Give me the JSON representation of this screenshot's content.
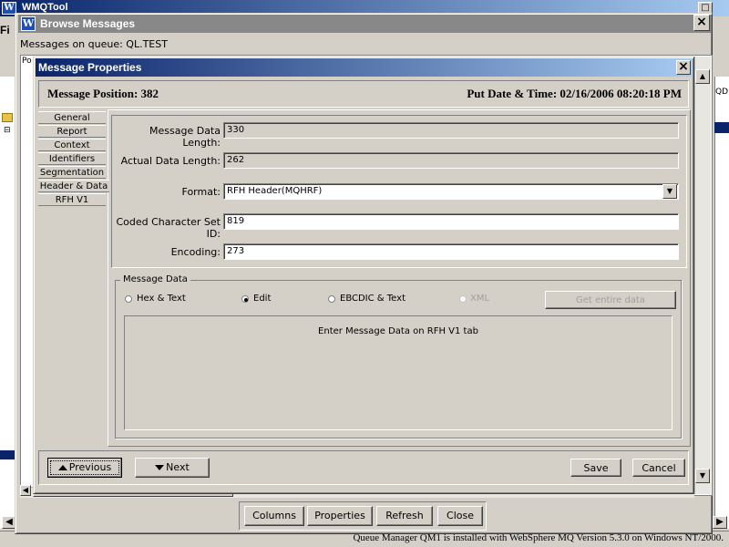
{
  "app": {
    "title": "WMQTool",
    "logo": "W",
    "menu_fragment": "Fi",
    "status_text": "Queue Manager QM1 is installed with WebSphere MQ Version 5.3.0 on Windows NT/2000."
  },
  "browse": {
    "title": "Browse Messages",
    "logo": "W",
    "queue_label": "Messages on queue: QL.TEST",
    "header_fragment": "Po",
    "right_fragment": "QD",
    "close": "×",
    "buttons": {
      "columns": "Columns",
      "properties": "Properties",
      "refresh": "Refresh",
      "close": "Close"
    }
  },
  "dialog": {
    "title": "Message Properties",
    "close": "×",
    "position": "Message Position: 382",
    "put_date": "Put Date & Time: 02/16/2006 08:20:18 PM",
    "tabs": [
      "General",
      "Report",
      "Context",
      "Identifiers",
      "Segmentation",
      "Header & Data",
      "RFH V1"
    ],
    "active_tab": "Header & Data",
    "fields": {
      "msg_len_label": "Message Data Length:",
      "msg_len_value": "330",
      "actual_len_label": "Actual Data Length:",
      "actual_len_value": "262",
      "format_label": "Format:",
      "format_value": "RFH Header(MQHRF)",
      "ccsid_label": "Coded Character Set ID:",
      "ccsid_value": "819",
      "encoding_label": "Encoding:",
      "encoding_value": "273"
    },
    "message_data": {
      "legend": "Message Data",
      "options": [
        "Hex & Text",
        "Edit",
        "EBCDIC & Text",
        "XML"
      ],
      "selected": "Edit",
      "get_entire": "Get entire data",
      "content": "Enter Message Data on RFH V1 tab"
    },
    "nav": {
      "previous": "Previous",
      "next": "Next",
      "save": "Save",
      "cancel": "Cancel"
    }
  },
  "colors": {
    "title_active": "#0a246a",
    "title_inactive": "#888888",
    "face": "#d4d0c8"
  }
}
